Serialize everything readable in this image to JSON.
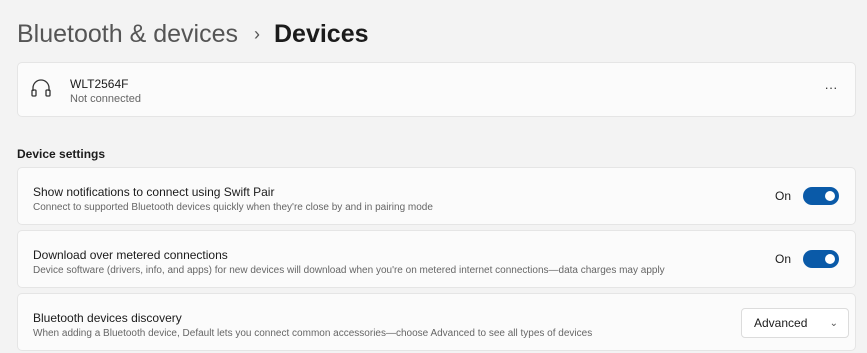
{
  "breadcrumb": {
    "parent": "Bluetooth & devices",
    "separator": "›",
    "current": "Devices"
  },
  "device": {
    "icon": "headphones-icon",
    "name": "WLT2564F",
    "status": "Not connected",
    "more_label": "···"
  },
  "device_settings": {
    "title": "Device settings",
    "items": [
      {
        "title": "Show notifications to connect using Swift Pair",
        "description": "Connect to supported Bluetooth devices quickly when they're close by and in pairing mode",
        "toggle_label": "On",
        "toggle_on": true
      },
      {
        "title": "Download over metered connections",
        "description": "Device software (drivers, info, and apps) for new devices will download when you're on metered internet connections—data charges may apply",
        "toggle_label": "On",
        "toggle_on": true
      },
      {
        "title": "Bluetooth devices discovery",
        "description": "When adding a Bluetooth device, Default lets you connect common accessories—choose Advanced to see all types of devices",
        "selected": "Advanced"
      }
    ]
  },
  "colors": {
    "accent": "#0a5aa8",
    "background": "#f3f3f3",
    "card": "#fbfbfb"
  }
}
